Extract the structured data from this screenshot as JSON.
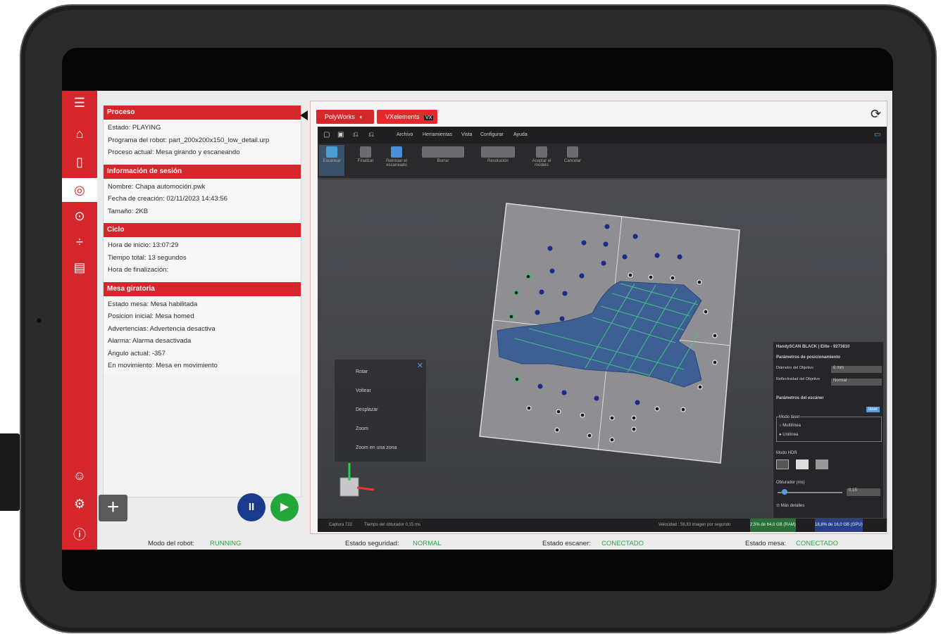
{
  "colors": {
    "accent_red": "#d4262b",
    "status_green": "#2aa842",
    "pause_blue": "#1a3a8c",
    "play_green": "#22a83a"
  },
  "sidebar": {
    "items": [
      {
        "icon": "menu-icon",
        "glyph": "☰"
      },
      {
        "icon": "home-icon",
        "glyph": "⌂"
      },
      {
        "icon": "document-icon",
        "glyph": "▯"
      },
      {
        "icon": "scan-icon",
        "glyph": "◎"
      },
      {
        "icon": "target-icon",
        "glyph": "⊙"
      },
      {
        "icon": "split-icon",
        "glyph": "÷"
      },
      {
        "icon": "report-icon",
        "glyph": "▤"
      },
      {
        "icon": "user-icon",
        "glyph": "☺"
      },
      {
        "icon": "gear-icon",
        "glyph": "⚙"
      },
      {
        "icon": "info-icon",
        "glyph": "ⓘ"
      }
    ]
  },
  "proceso": {
    "title": "Proceso",
    "rows": [
      "Estado: PLAYING",
      "Programa del robot: part_200x200x150_low_detail.urp",
      "Proceso actual: Mesa girando y escaneando"
    ]
  },
  "sesion": {
    "title": "Información de sesión",
    "rows": [
      "Nombre: Chapa automoción.pwk",
      "Fecha de creación: 02/11/2023 14:43:56",
      "Tamaño: 2KB"
    ]
  },
  "ciclo": {
    "title": "Ciclo",
    "rows": [
      "Hora de inicio: 13:07:29",
      "Tiempo total: 13 segundos",
      "Hora de finalización:"
    ]
  },
  "mesa": {
    "title": "Mesa giratoria",
    "rows": [
      "Estado mesa: Mesa habilitada",
      "Posicion inicial: Mesa homed",
      "Advertencias: Advertencia desactiva",
      "Alarma: Alarma desactivada",
      "Ángulo actual: -357",
      "En movimiento: Mesa en movimiento"
    ]
  },
  "controls": {
    "add_label": "+",
    "pause_label": "II",
    "play_label": "▶"
  },
  "tabs": {
    "polyworks": "PolyWorks",
    "vxelements": "VXelements"
  },
  "vx": {
    "menu": [
      "Archivo",
      "Herramientas",
      "Vista",
      "Configurar",
      "Ayuda"
    ],
    "ribbon": [
      "Escanear",
      "Finalizar",
      "Reiniciar el escaneado",
      "Borrar",
      "Resolución",
      "Aceptar el modelo",
      "Cancelar"
    ],
    "ctx_menu": [
      "Rotar",
      "Voltear",
      "Desplazar",
      "Zoom",
      "Zoom en una zona"
    ],
    "status": {
      "capture": "Captura 722",
      "shutter": "Tiempo del obturador 0,15 ms",
      "speed": "Velocidad : 56,83 imagen por segundo",
      "ram": "2,5% de 64,0 GB (RAM)",
      "gpu": "18,8% de 16,0 GB (GPU)"
    },
    "scanner_panel": {
      "title": "HandySCAN BLACK | Elite - 9273810",
      "pos_params": "Parámetros de posicionamiento",
      "target_diam": "Diámetro del Objetivo",
      "target_diam_val": "6 mm",
      "target_refl": "Reflectividad del Objetivo",
      "target_refl_val": "Normal",
      "scanner_params": "Parámetros del escáner",
      "laser_btn": "láser",
      "laser_mode": "Modo láser",
      "multiline": "Multilínea",
      "uniline": "Unilínea",
      "hdr_mode": "Modo HDR",
      "shutter_label": "Obturador (ms)",
      "shutter_val": "0,15",
      "more": "Más detalles"
    }
  },
  "status_bar": {
    "robot_mode_label": "Modo del robot:",
    "robot_mode_value": "RUNNING",
    "safety_label": "Estado seguridad:",
    "safety_value": "NORMAL",
    "scanner_label": "Estado escaner:",
    "scanner_value": "CONECTADO",
    "table_label": "Estado mesa:",
    "table_value": "CONECTADO"
  }
}
